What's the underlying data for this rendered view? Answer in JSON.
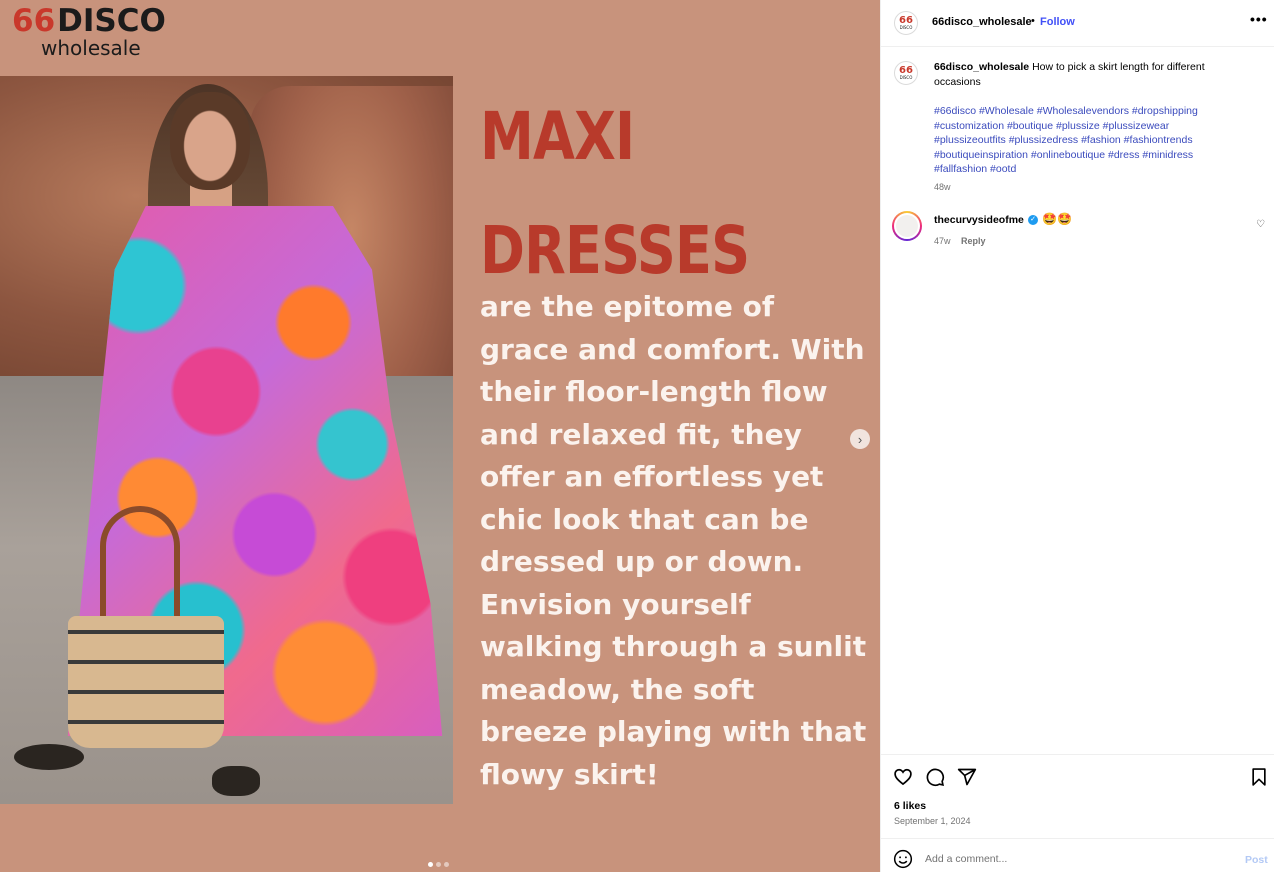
{
  "media": {
    "brand": {
      "num": "66",
      "word": "DISCO",
      "sub": "wholesale"
    },
    "headline": [
      "MAXI",
      "DRESSES"
    ],
    "body": "are the epitome of grace and comfort. With their floor-length flow and relaxed fit, they offer an effortless yet chic look that can be dressed up or down. Envision yourself walking through a sunlit meadow, the soft breeze playing with that flowy skirt!",
    "next_icon": "chevron-right-icon",
    "carousel": {
      "count": 3,
      "active_index": 0
    },
    "colors": {
      "background": "#c8937c",
      "headline": "#b83a2b",
      "body": "#fbf3ee"
    }
  },
  "header": {
    "avatar_num": "66",
    "avatar_word": "DISCO",
    "username": "66disco_wholesale",
    "separator": "•",
    "follow": "Follow",
    "more_icon": "more-horizontal-icon",
    "more_glyph": "•••"
  },
  "caption": {
    "avatar_num": "66",
    "avatar_word": "DISCO",
    "username": "66disco_wholesale",
    "text": "How to pick a skirt length for different occasions",
    "hashtags": "#66disco #Wholesale #Wholesalevendors #dropshipping #customization #boutique #plussize #plussizewear #plussizeoutfits #plussizedress #fashion #fashiontrends #boutiqueinspiration #onlineboutique #dress #minidress #fallfashion #ootd",
    "time": "48w"
  },
  "comment": {
    "username": "thecurvysideofme",
    "verified_glyph": "✓",
    "text": "🤩🤩",
    "time": "47w",
    "reply": "Reply",
    "like_icon": "heart-outline-icon",
    "like_glyph": "♡"
  },
  "actions": {
    "icons": [
      "heart-icon",
      "comment-icon",
      "share-icon",
      "bookmark-icon"
    ],
    "likes": "6 likes",
    "date": "September 1, 2024"
  },
  "comment_box": {
    "emoji_icon": "emoji-icon",
    "placeholder": "Add a comment...",
    "value": "",
    "post": "Post"
  }
}
